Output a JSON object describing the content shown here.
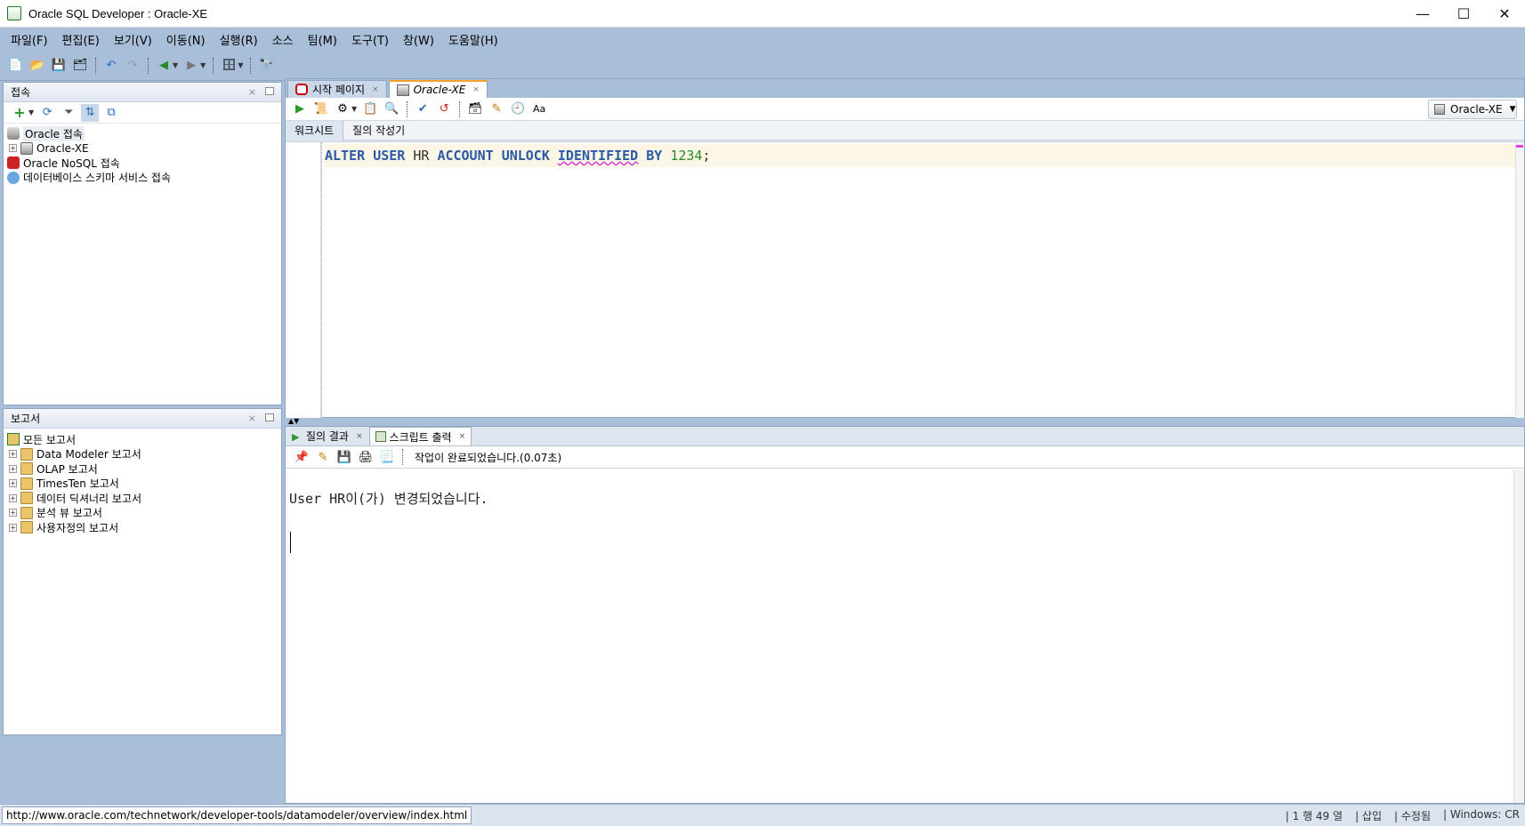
{
  "window": {
    "title": "Oracle SQL Developer : Oracle-XE",
    "controls": {
      "minimize": "—",
      "maximize": "☐",
      "close": "✕"
    }
  },
  "menu": [
    "파일(F)",
    "편집(E)",
    "보기(V)",
    "이동(N)",
    "실행(R)",
    "소스",
    "팀(M)",
    "도구(T)",
    "창(W)",
    "도움말(H)"
  ],
  "connections_panel": {
    "title": "접속",
    "items": [
      {
        "label": "Oracle 접속",
        "icon": "database-icon",
        "level": 0
      },
      {
        "label": "Oracle-XE",
        "icon": "connection-icon",
        "level": 1,
        "expandable": true
      },
      {
        "label": "Oracle NoSQL 접속",
        "icon": "nosql-icon",
        "level": 0
      },
      {
        "label": "데이터베이스 스키마 서비스 접속",
        "icon": "cloud-icon",
        "level": 0
      }
    ]
  },
  "reports_panel": {
    "title": "보고서",
    "items": [
      {
        "label": "모든 보고서",
        "level": 0
      },
      {
        "label": "Data Modeler 보고서",
        "level": 1
      },
      {
        "label": "OLAP 보고서",
        "level": 1
      },
      {
        "label": "TimesTen 보고서",
        "level": 1
      },
      {
        "label": "데이터 딕셔너리 보고서",
        "level": 1
      },
      {
        "label": "분석 뷰 보고서",
        "level": 1
      },
      {
        "label": "사용자정의 보고서",
        "level": 1
      }
    ]
  },
  "editor": {
    "tabs": [
      {
        "label": "시작 페이지",
        "active": false
      },
      {
        "label": "Oracle-XE",
        "active": true
      }
    ],
    "connection_selector": "Oracle-XE",
    "subtabs": [
      "워크시트",
      "질의 작성기"
    ],
    "code": {
      "kw1": "ALTER",
      "kw2": "USER",
      "id1": "HR",
      "kw3": "ACCOUNT",
      "kw4": "UNLOCK",
      "kw5": "IDENTIFIED",
      "kw6": "BY",
      "num": "1234",
      "end": ";"
    }
  },
  "output": {
    "tabs": [
      {
        "label": "질의 결과",
        "active": false
      },
      {
        "label": "스크립트 출력",
        "active": true
      }
    ],
    "status_message": "작업이 완료되었습니다.(0.07초)",
    "text": "User HR이(가) 변경되었습니다."
  },
  "statusbar": {
    "url": "http://www.oracle.com/technetwork/developer-tools/datamodeler/overview/index.html",
    "position": "| 1 행 49 열",
    "mode": "| 삽입",
    "modified": "| 수정됨",
    "line_ending": "| Windows: CR"
  },
  "colors": {
    "chrome": "#a9bfd9",
    "keyword": "#2a5aa6",
    "number": "#2a8a2a",
    "current_line": "#fbf6e6",
    "active_tab_accent": "#f0a030"
  }
}
